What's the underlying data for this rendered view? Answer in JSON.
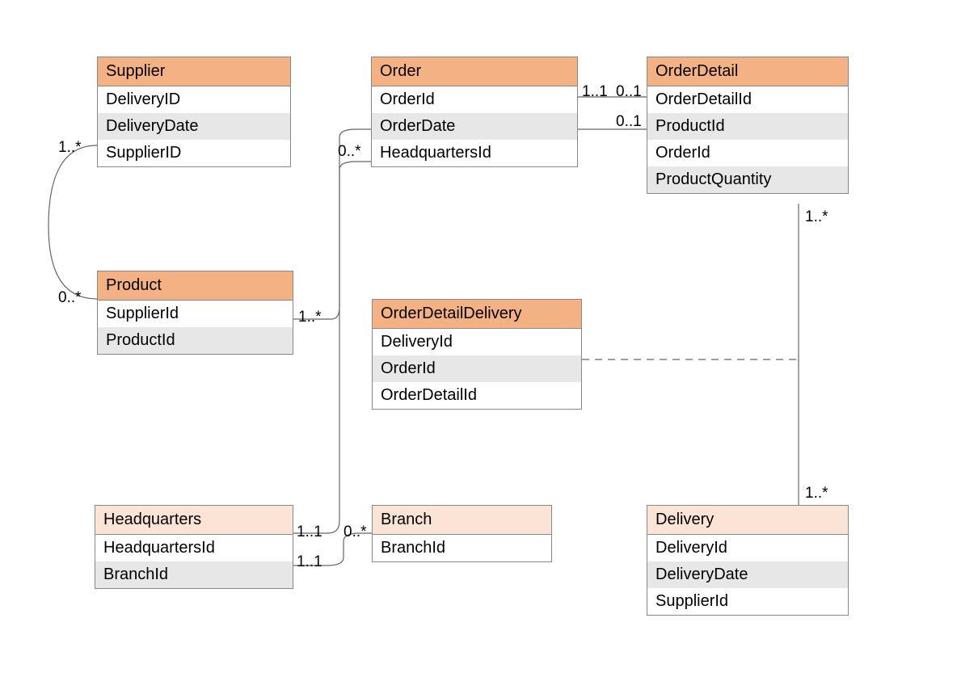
{
  "entities": {
    "supplier": {
      "title": "Supplier",
      "rows": [
        "DeliveryID",
        "DeliveryDate",
        "SupplierID"
      ]
    },
    "order": {
      "title": "Order",
      "rows": [
        "OrderId",
        "OrderDate",
        "HeadquartersId"
      ]
    },
    "orderDetail": {
      "title": "OrderDetail",
      "rows": [
        "OrderDetailId",
        "ProductId",
        "OrderId",
        "ProductQuantity"
      ]
    },
    "product": {
      "title": "Product",
      "rows": [
        "SupplierId",
        "ProductId"
      ]
    },
    "orderDetailDelivery": {
      "title": "OrderDetailDelivery",
      "rows": [
        "DeliveryId",
        "OrderId",
        "OrderDetailId"
      ]
    },
    "headquarters": {
      "title": "Headquarters",
      "rows": [
        "HeadquartersId",
        "BranchId"
      ]
    },
    "branch": {
      "title": "Branch",
      "rows": [
        "BranchId"
      ]
    },
    "delivery": {
      "title": "Delivery",
      "rows": [
        "DeliveryId",
        "DeliveryDate",
        "SupplierId"
      ]
    }
  },
  "multiplicities": {
    "supplier_product_top": "1..*",
    "supplier_product_bottom": "0..*",
    "product_orderdetail_left": "1..*",
    "product_orderdetail_top": "0..*",
    "order_orderdetail_left": "1..1",
    "order_orderdetail_right": "0..1",
    "orderdetail_prod_right": "0..1",
    "orderdetail_delivery_top": "1..*",
    "orderdetail_delivery_bottom": "1..*",
    "hq_order_left": "1..1",
    "hq_branch_left": "1..1",
    "hq_branch_right": "0..*"
  }
}
